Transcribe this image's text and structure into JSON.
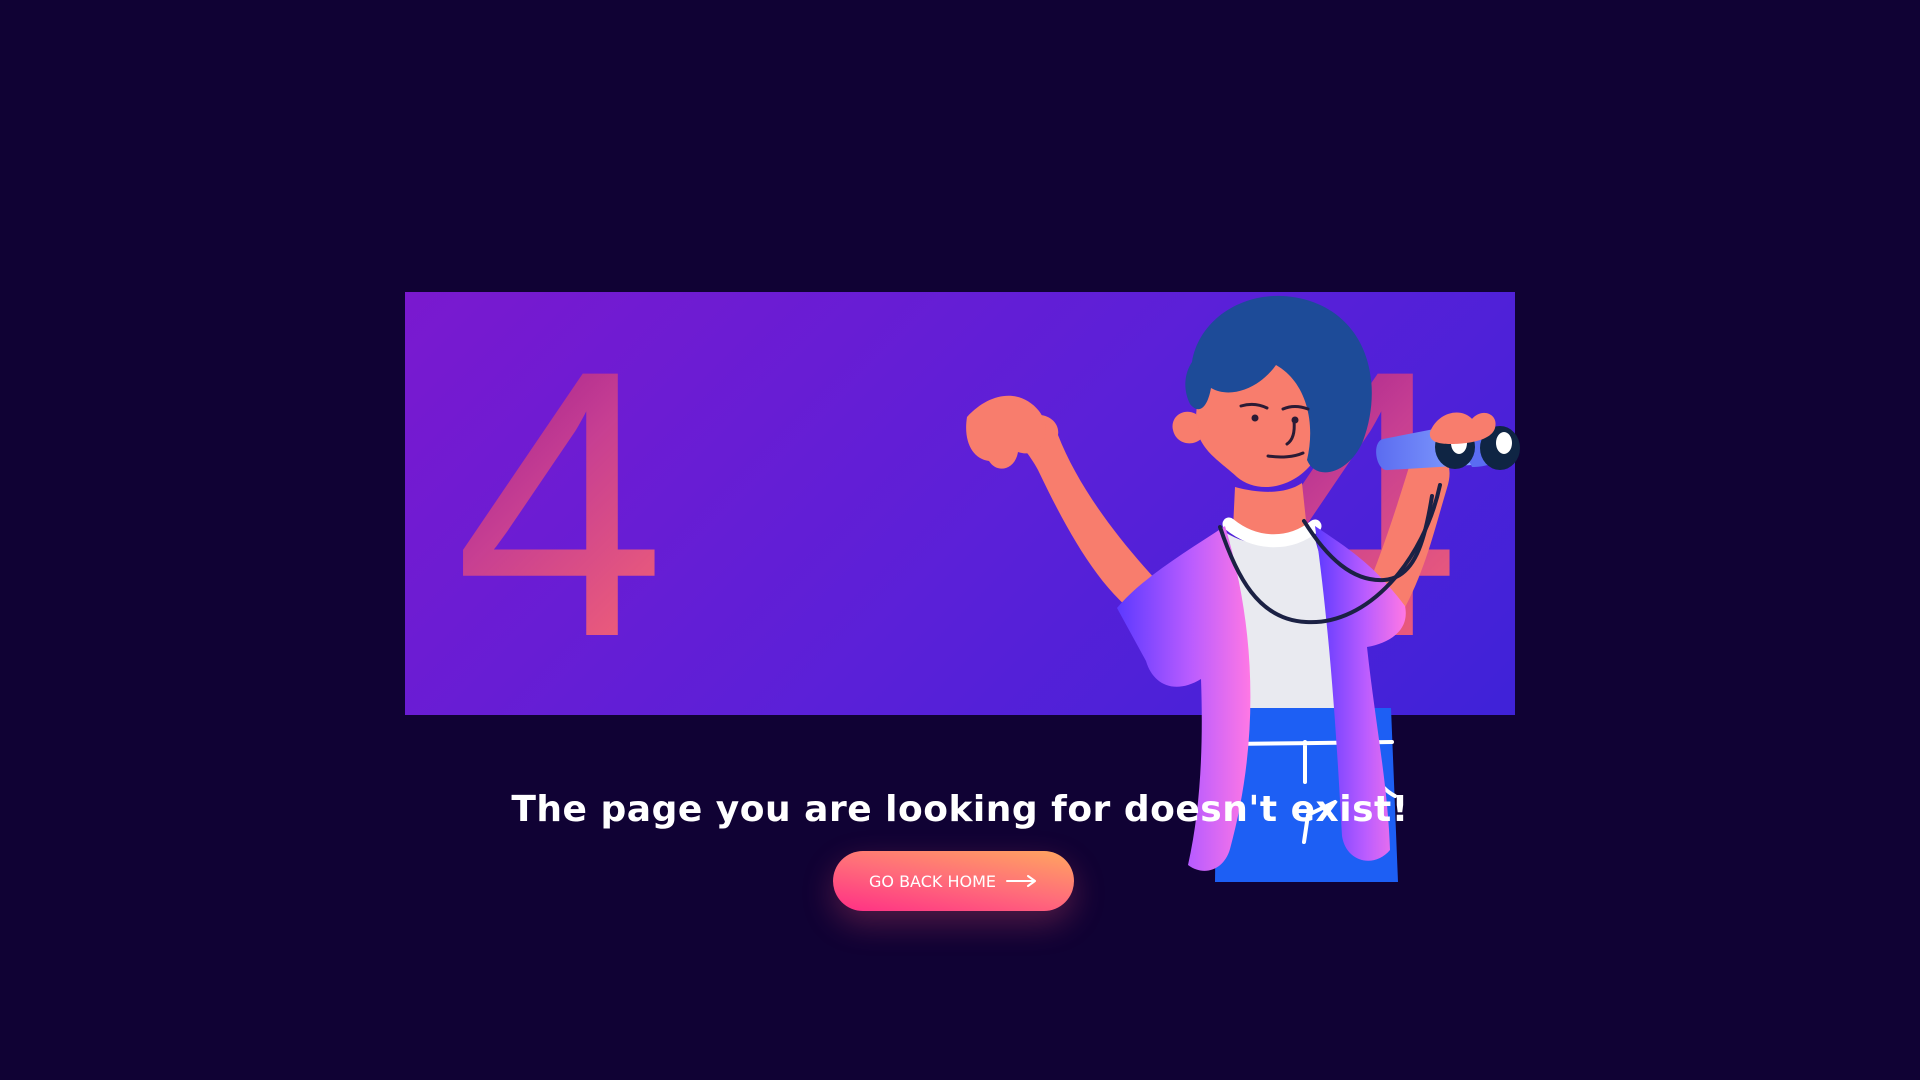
{
  "error": {
    "code_left_digit": "4",
    "code_right_digit": "4",
    "message": "The page you are looking for doesn't exist!"
  },
  "actions": {
    "home_button_label": "GO BACK HOME",
    "home_button_icon": "arrow-right-icon"
  },
  "illustration": {
    "subject": "person-with-binoculars"
  },
  "colors": {
    "background": "#100234",
    "panel_start": "#7a19cf",
    "panel_end": "#3f22d8",
    "digit_start": "#8d0f8e",
    "digit_end": "#ff6b6e",
    "button_start": "#ff2f85",
    "button_end": "#ffa65f"
  }
}
